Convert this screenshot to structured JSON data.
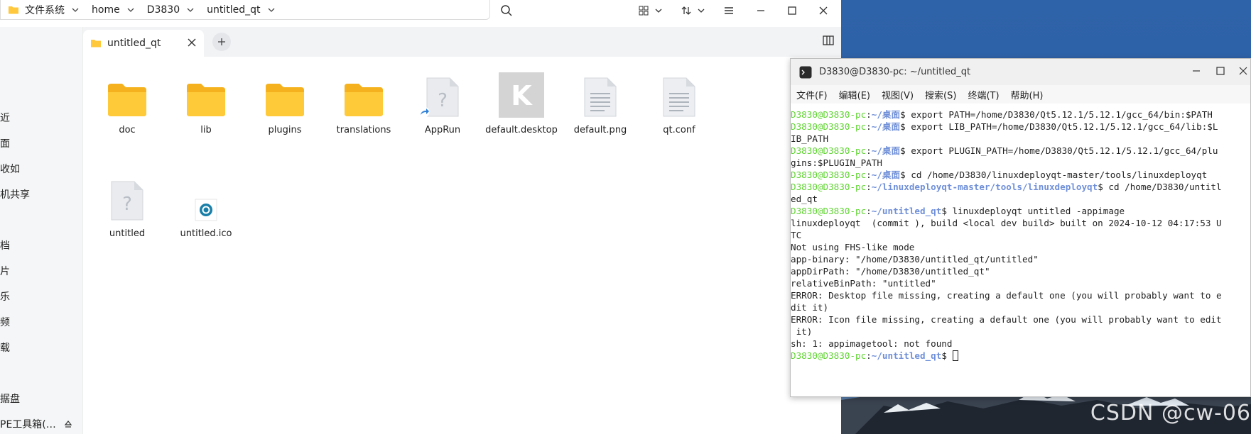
{
  "file_manager": {
    "breadcrumb": [
      {
        "label": "文件系统"
      },
      {
        "label": "home"
      },
      {
        "label": "D3830"
      },
      {
        "label": "untitled_qt"
      }
    ],
    "tab": {
      "label": "untitled_qt"
    },
    "sidebar": {
      "items": [
        {
          "label": "近"
        },
        {
          "label": "面"
        },
        {
          "label": "收如"
        },
        {
          "label": "机共享"
        },
        {
          "label": "档"
        },
        {
          "label": "片"
        },
        {
          "label": "乐"
        },
        {
          "label": "频"
        },
        {
          "label": "载"
        },
        {
          "label": "据盘"
        },
        {
          "label": "PE工具箱(…"
        }
      ]
    },
    "files": [
      {
        "name": "doc",
        "type": "folder"
      },
      {
        "name": "lib",
        "type": "folder"
      },
      {
        "name": "plugins",
        "type": "folder"
      },
      {
        "name": "translations",
        "type": "folder"
      },
      {
        "name": "AppRun",
        "type": "symlink-unknown"
      },
      {
        "name": "default.desktop",
        "type": "desktop"
      },
      {
        "name": "default.png",
        "type": "text"
      },
      {
        "name": "qt.conf",
        "type": "text"
      },
      {
        "name": "untitled",
        "type": "unknown"
      },
      {
        "name": "untitled.ico",
        "type": "ico"
      }
    ],
    "folder_color": "#ffc83d"
  },
  "terminal": {
    "title": "D3830@D3830-pc: ~/untitled_qt",
    "menu": [
      "文件(F)",
      "编辑(E)",
      "视图(V)",
      "搜索(S)",
      "终端(T)",
      "帮助(H)"
    ],
    "lines": [
      {
        "user": "D3830@D3830-pc",
        "path": "~/桌面",
        "text": "$ export PATH=/home/D3830/Qt5.12.1/5.12.1/gcc_64/bin:$PATH"
      },
      {
        "user": "D3830@D3830-pc",
        "path": "~/桌面",
        "text": "$ export LIB_PATH=/home/D3830/Qt5.12.1/5.12.1/gcc_64/lib:$L"
      },
      {
        "text": "IB_PATH"
      },
      {
        "user": "D3830@D3830-pc",
        "path": "~/桌面",
        "text": "$ export PLUGIN_PATH=/home/D3830/Qt5.12.1/5.12.1/gcc_64/plu"
      },
      {
        "text": "gins:$PLUGIN_PATH"
      },
      {
        "user": "D3830@D3830-pc",
        "path": "~/桌面",
        "text": "$ cd /home/D3830/linuxdeployqt-master/tools/linuxdeployqt"
      },
      {
        "user": "D3830@D3830-pc",
        "path": "~/linuxdeployqt-master/tools/linuxdeployqt",
        "text": "$ cd /home/D3830/untitl"
      },
      {
        "text": "ed_qt"
      },
      {
        "user": "D3830@D3830-pc",
        "path": "~/untitled_qt",
        "text": "$ linuxdeployqt untitled -appimage"
      },
      {
        "text": "linuxdeployqt  (commit ), build <local dev build> built on 2024-10-12 04:17:53 U"
      },
      {
        "text": "TC"
      },
      {
        "text": "Not using FHS-like mode"
      },
      {
        "text": "app-binary: \"/home/D3830/untitled_qt/untitled\""
      },
      {
        "text": "appDirPath: \"/home/D3830/untitled_qt\""
      },
      {
        "text": "relativeBinPath: \"untitled\""
      },
      {
        "text": "ERROR: Desktop file missing, creating a default one (you will probably want to e"
      },
      {
        "text": "dit it)"
      },
      {
        "text": "ERROR: Icon file missing, creating a default one (you will probably want to edit"
      },
      {
        "text": " it)"
      },
      {
        "text": "sh: 1: appimagetool: not found"
      },
      {
        "user": "D3830@D3830-pc",
        "path": "~/untitled_qt",
        "text": "$ ",
        "cursor": true
      }
    ],
    "colors": {
      "user": "#5fd431",
      "path": "#6f8fd8"
    }
  },
  "desktop": {
    "watermark": "CSDN @cw-06"
  }
}
